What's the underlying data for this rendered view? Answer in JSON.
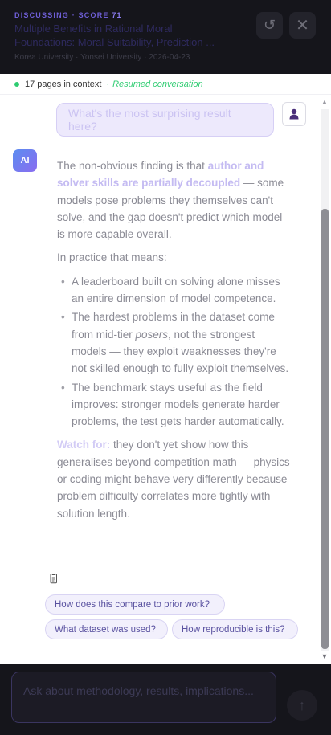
{
  "header": {
    "label": "DISCUSSING · SCORE",
    "score": "71",
    "title": "Multiple Benefits in Rational Moral Foundations: Moral Suitability, Prediction ...",
    "meta": "Korea University · Yonsei University · 2026-04-23",
    "reload_icon": "reload-icon",
    "close_icon": "close-icon"
  },
  "context": {
    "pages": "17 pages in context",
    "separator": "·",
    "status": "Resumed conversation",
    "status_color": "#2ecc71"
  },
  "user_message": {
    "text": "What's the most surprising result here?",
    "avatar_icon": "user-icon"
  },
  "ai_message": {
    "avatar_label": "AI",
    "intro_before": "The non-obvious finding is that ",
    "intro_highlight": "author and solver skills are partially decoupled",
    "intro_after": " — some models pose problems they themselves can't solve, and the gap doesn't predict which model is more capable overall.",
    "practice": "In practice that means:",
    "bullet1": "A leaderboard built on solving alone misses an entire dimension of model competence.",
    "bullet2_before": "The hardest problems in the dataset come from mid-tier ",
    "bullet2_em": "posers",
    "bullet2_after": ", not the strongest models — they exploit weaknesses they're not skilled enough to fully exploit themselves.",
    "bullet3": "The benchmark stays useful as the field improves: stronger models generate harder problems, the test gets harder automatically.",
    "watch_label": "Watch for:",
    "watch_text": " they don't yet show how this generalises beyond competition math — physics or coding might behave very differently because problem difficulty correlates more tightly with solution length.",
    "copy_icon": "copy-icon"
  },
  "suggestions": [
    "How does this compare to prior work?",
    "What dataset was used?",
    "How reproducible is this?"
  ],
  "composer": {
    "placeholder": "Ask about methodology, results, implications...",
    "send_icon": "send-arrow-icon"
  },
  "colors": {
    "accent": "#6f5fd8",
    "header_bg": "#15151b",
    "chip_bg": "#f2f0fc"
  }
}
